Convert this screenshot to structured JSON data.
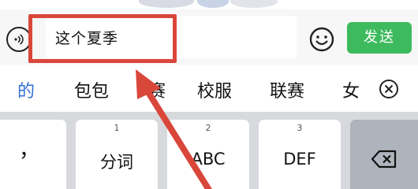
{
  "input": {
    "value": "这个夏季",
    "send_label": "发送"
  },
  "candidates": [
    "的",
    "包包",
    "赛",
    "校服",
    "联赛",
    "女"
  ],
  "keys": {
    "punct": "，",
    "key1": {
      "num": "1",
      "label": "分词"
    },
    "key2": {
      "num": "2",
      "label": "ABC"
    },
    "key3": {
      "num": "3",
      "label": "DEF"
    }
  },
  "colors": {
    "send": "#3dba5d",
    "highlight": "#d9473a",
    "first_candidate": "#2f6fd0"
  },
  "icons": {
    "voice": "voice-icon",
    "emoji": "emoji-icon",
    "close": "close-circle-icon",
    "backspace": "backspace-icon",
    "arrow": "annotation-arrow"
  }
}
